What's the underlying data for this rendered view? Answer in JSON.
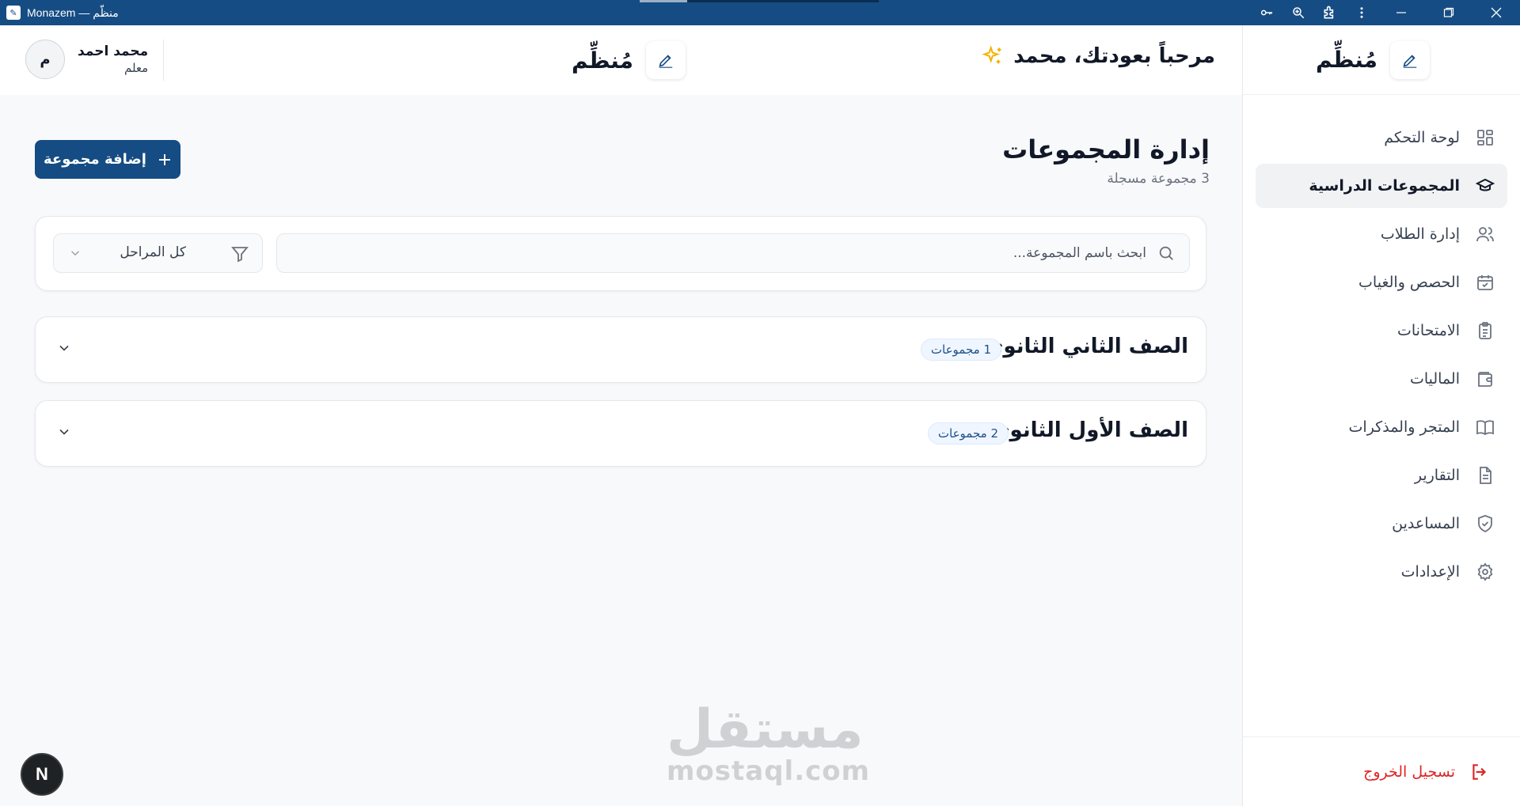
{
  "window": {
    "title": "Monazem — منظّم",
    "icons": [
      "key-icon",
      "zoom-icon",
      "extension-icon",
      "more-icon",
      "minimize-icon",
      "maximize-icon",
      "close-icon"
    ]
  },
  "sidebar": {
    "brand": "مُنظِّم",
    "items": [
      {
        "label": "لوحة التحكم",
        "icon": "dashboard-icon",
        "active": false
      },
      {
        "label": "المجموعات الدراسية",
        "icon": "graduation-cap-icon",
        "active": true
      },
      {
        "label": "إدارة الطلاب",
        "icon": "users-icon",
        "active": false
      },
      {
        "label": "الحصص والغياب",
        "icon": "calendar-check-icon",
        "active": false
      },
      {
        "label": "الامتحانات",
        "icon": "clipboard-icon",
        "active": false
      },
      {
        "label": "الماليات",
        "icon": "wallet-icon",
        "active": false
      },
      {
        "label": "المتجر والمذكرات",
        "icon": "book-icon",
        "active": false
      },
      {
        "label": "التقارير",
        "icon": "file-text-icon",
        "active": false
      },
      {
        "label": "المساعدين",
        "icon": "shield-icon",
        "active": false
      },
      {
        "label": "الإعدادات",
        "icon": "gear-icon",
        "active": false
      }
    ],
    "logout_label": "تسجيل الخروج"
  },
  "header": {
    "welcome": "مرحباً بعودتك، محمد",
    "brand": "مُنظِّم",
    "user_name": "محمد احمد",
    "user_role": "معلم",
    "avatar_initial": "م"
  },
  "main": {
    "title": "إدارة المجموعات",
    "subtitle": "3 مجموعة مسجلة",
    "add_button": "إضافة مجموعة",
    "search_placeholder": "ابحث باسم المجموعة...",
    "stage_filter_value": "كل المراحل",
    "stages": [
      {
        "name": "الصف الثاني الثانوي",
        "badge": "1 مجموعات"
      },
      {
        "name": "الصف الأول الثانوي",
        "badge": "2 مجموعات"
      }
    ]
  },
  "watermark": {
    "arabic": "مستقل",
    "latin": "mostaql.com"
  },
  "dev_badge": "N",
  "colors": {
    "primary": "#154c83",
    "accent_star": "#f5b301",
    "danger": "#dc2626"
  }
}
